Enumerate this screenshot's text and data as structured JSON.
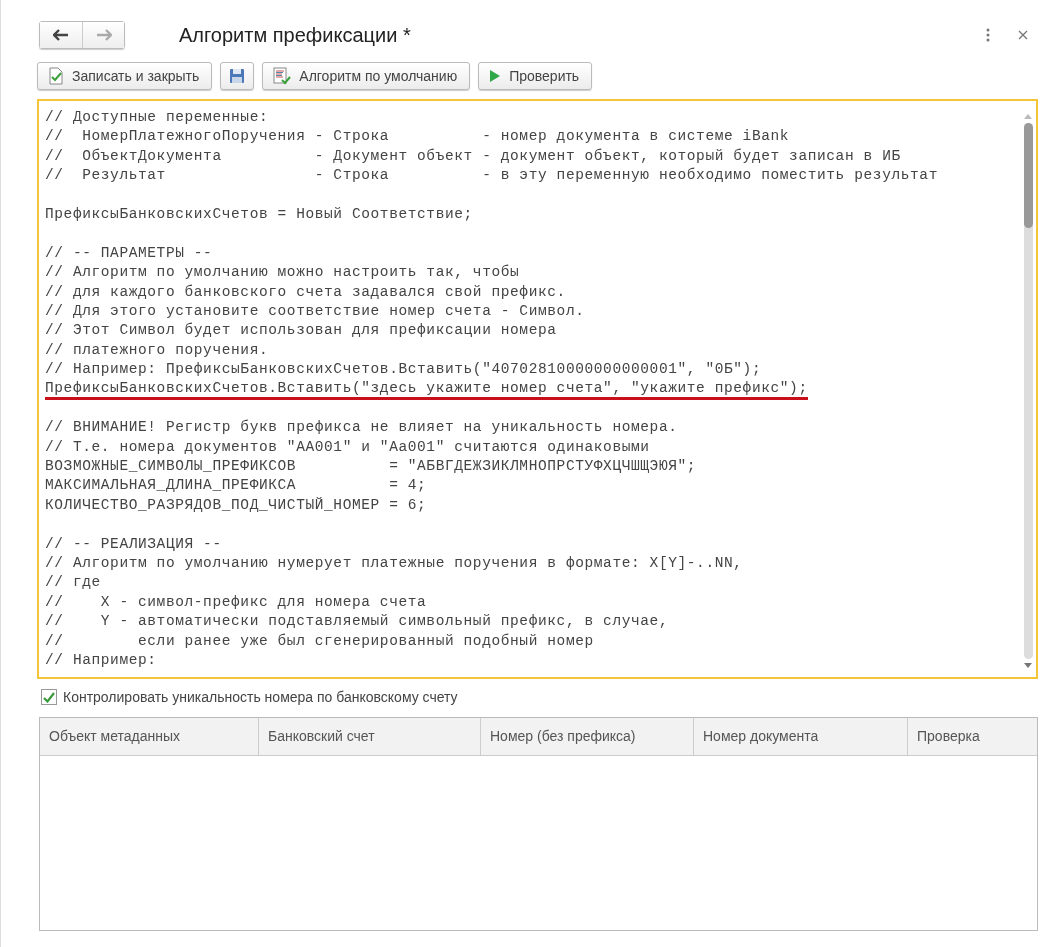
{
  "window": {
    "title": "Алгоритм префиксации *"
  },
  "nav": {
    "back_disabled": false,
    "forward_disabled": true
  },
  "toolbar": [
    {
      "kind": "text",
      "label": "Записать и закрыть"
    },
    {
      "kind": "icon"
    },
    {
      "kind": "text",
      "label": "Алгоритм по умолчанию"
    },
    {
      "kind": "text",
      "label": "Проверить"
    }
  ],
  "editor": {
    "lines": [
      {
        "kind": "code",
        "text": "// Доступные переменные:",
        "underlined": false
      },
      {
        "kind": "code",
        "text": "//  НомерПлатежногоПоручения - Строка          - номер документа в системе iBank",
        "underlined": false
      },
      {
        "kind": "code",
        "text": "//  ОбъектДокумента          - Документ объект - документ объект, который будет записан в ИБ",
        "underlined": false
      },
      {
        "kind": "code",
        "text": "//  Результат                - Строка          - в эту переменную необходимо поместить результат",
        "underlined": false
      },
      {
        "kind": "blank"
      },
      {
        "kind": "code",
        "text": "ПрефиксыБанковскихСчетов = Новый Соответствие;",
        "underlined": false
      },
      {
        "kind": "blank"
      },
      {
        "kind": "code",
        "text": "// -- ПАРАМЕТРЫ --",
        "underlined": false
      },
      {
        "kind": "code",
        "text": "// Алгоритм по умолчанию можно настроить так, чтобы",
        "underlined": false
      },
      {
        "kind": "code",
        "text": "// для каждого банковского счета задавался свой префикс.",
        "underlined": false
      },
      {
        "kind": "code",
        "text": "// Для этого установите соответствие номер счета - Символ.",
        "underlined": false
      },
      {
        "kind": "code",
        "text": "// Этот Символ будет использован для префиксации номера",
        "underlined": false
      },
      {
        "kind": "code",
        "text": "// платежного поручения.",
        "underlined": false
      },
      {
        "kind": "code",
        "text": "// Например: ПрефиксыБанковскихСчетов.Вставить(\"40702810000000000001\", \"0Б\");",
        "underlined": false
      },
      {
        "kind": "code",
        "text": "ПрефиксыБанковскихСчетов.Вставить(\"здесь укажите номер счета\", \"укажите префикс\");",
        "underlined": true
      },
      {
        "kind": "blank"
      },
      {
        "kind": "code",
        "text": "// ВНИМАНИЕ! Регистр букв префикса не влияет на уникальность номера.",
        "underlined": false
      },
      {
        "kind": "code",
        "text": "// Т.е. номера документов \"АА001\" и \"Аа001\" считаются одинаковыми",
        "underlined": false
      },
      {
        "kind": "code",
        "text": "ВОЗМОЖНЫЕ_СИМВОЛЫ_ПРЕФИКСОВ          = \"АБВГДЕЖЗИКЛМНОПРСТУФХЦЧШЩЭЮЯ\";",
        "underlined": false
      },
      {
        "kind": "code",
        "text": "МАКСИМАЛЬНАЯ_ДЛИНА_ПРЕФИКСА          = 4;",
        "underlined": false
      },
      {
        "kind": "code",
        "text": "КОЛИЧЕСТВО_РАЗРЯДОВ_ПОД_ЧИСТЫЙ_НОМЕР = 6;",
        "underlined": false
      },
      {
        "kind": "blank"
      },
      {
        "kind": "code",
        "text": "// -- РЕАЛИЗАЦИЯ --",
        "underlined": false
      },
      {
        "kind": "code",
        "text": "// Алгоритм по умолчанию нумерует платежные поручения в формате: X[Y]-..NN,",
        "underlined": false
      },
      {
        "kind": "code",
        "text": "// где",
        "underlined": false
      },
      {
        "kind": "code",
        "text": "//    X - символ-префикс для номера счета",
        "underlined": false
      },
      {
        "kind": "code",
        "text": "//    Y - автоматически подставляемый символьный префикс, в случае,",
        "underlined": false
      },
      {
        "kind": "code",
        "text": "//        если ранее уже был сгенерированный подобный номер",
        "underlined": false
      },
      {
        "kind": "code",
        "text": "// Например:",
        "underlined": false
      }
    ]
  },
  "unique_check": {
    "label": "Контролировать уникальность номера по банковскому счету",
    "checked": true
  },
  "table": {
    "columns": [
      "Объект метаданных",
      "Банковский счет",
      "Номер (без префикса)",
      "Номер документа",
      "Проверка"
    ]
  }
}
